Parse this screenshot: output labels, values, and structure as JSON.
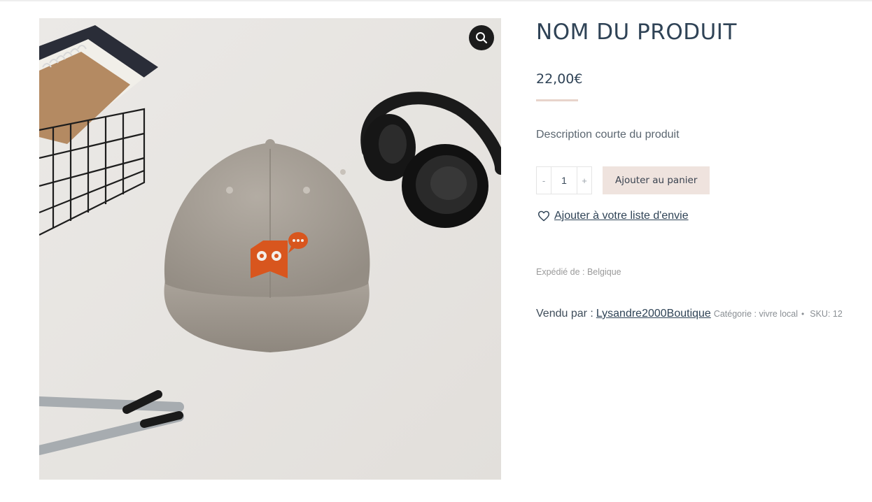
{
  "product": {
    "title": "NOM DU PRODUIT",
    "price": "22,00€",
    "short_description": "Description courte du produit",
    "quantity": "1",
    "image_alt": "Casquette snapback grise avec logo brodé orange"
  },
  "cart": {
    "minus_label": "-",
    "plus_label": "+",
    "add_to_cart_label": "Ajouter au panier"
  },
  "wishlist": {
    "label": "Ajouter à votre liste d'envie"
  },
  "shipping": {
    "label": "Expédié de : Belgique"
  },
  "meta": {
    "sold_by_label": "Vendu par :",
    "vendor": "Lysandre2000Boutique",
    "category": "Catégorie : vivre local",
    "separator": "•",
    "sku": "SKU: 12"
  },
  "icons": {
    "zoom": "magnifier-icon",
    "wishlist": "heart-icon"
  },
  "colors": {
    "title": "#2f4356",
    "button_bg": "#efe3de",
    "price_rule": "#e8d4cb",
    "zoom_bg": "#1c1c1c"
  }
}
